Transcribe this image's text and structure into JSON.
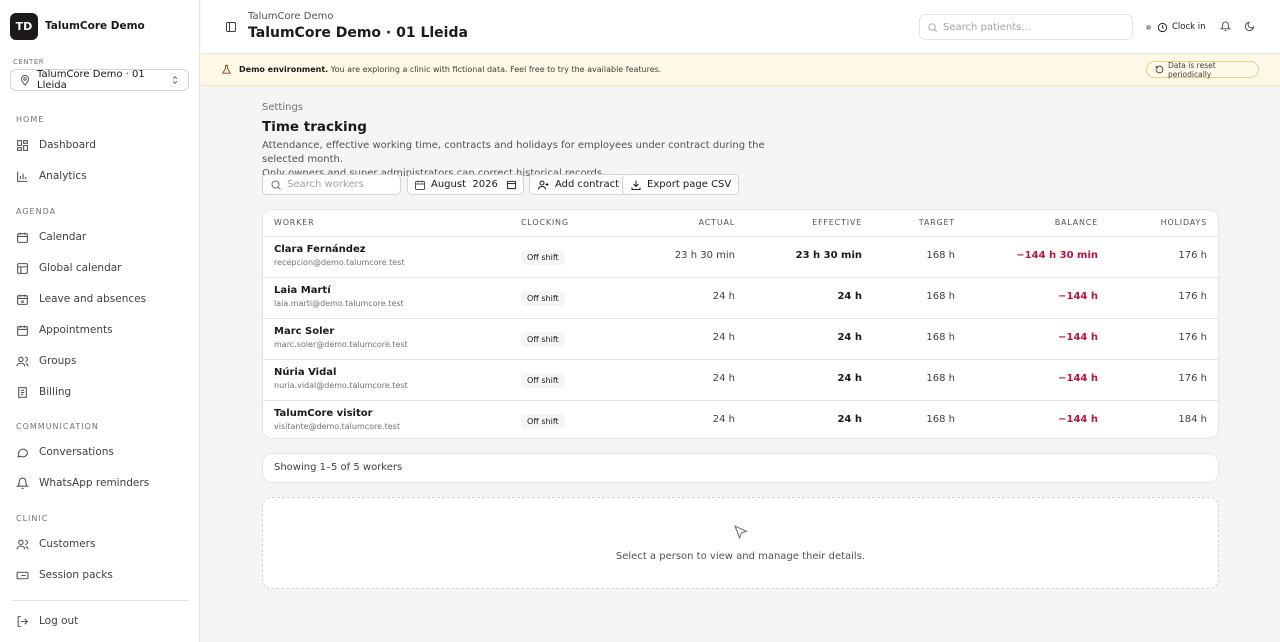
{
  "sidebar": {
    "logo_initials": "TD",
    "brand": "TalumCore Demo",
    "center_label": "CENTER",
    "center_value": "TalumCore Demo · 01 Lleida",
    "sections": {
      "home": "HOME",
      "agenda": "AGENDA",
      "communication": "COMMUNICATION",
      "clinic": "CLINIC"
    },
    "items": {
      "dashboard": "Dashboard",
      "analytics": "Analytics",
      "calendar": "Calendar",
      "global_calendar": "Global calendar",
      "leave": "Leave and absences",
      "appointments": "Appointments",
      "groups": "Groups",
      "billing": "Billing",
      "conversations": "Conversations",
      "whatsapp": "WhatsApp reminders",
      "customers": "Customers",
      "session_packs": "Session packs"
    },
    "logout": "Log out"
  },
  "header": {
    "breadcrumb": "TalumCore Demo",
    "title": "TalumCore Demo · 01 Lleida",
    "search_placeholder": "Search patients...",
    "clock_in": "Clock in"
  },
  "banner": {
    "bold": "Demo environment.",
    "text": " You are exploring a clinic with fictional data. Feel free to try the available features.",
    "reset_label": "Data is reset periodically"
  },
  "page": {
    "breadcrumb": "Settings",
    "title": "Time tracking",
    "description_1": "Attendance, effective working time, contracts and holidays for employees under contract during the selected month.",
    "description_2": "Only owners and super administrators can correct historical records."
  },
  "toolbar": {
    "search_placeholder": "Search workers",
    "month_value": "August  2026",
    "add_contract": "Add contract",
    "export_csv": "Export page CSV"
  },
  "table": {
    "headers": {
      "worker": "WORKER",
      "clocking": "CLOCKING",
      "actual": "ACTUAL",
      "effective": "EFFECTIVE",
      "target": "TARGET",
      "balance": "BALANCE",
      "holidays": "HOLIDAYS"
    },
    "rows": [
      {
        "name": "Clara Fernández",
        "email": "recepcion@demo.talumcore.test",
        "clocking": "Off shift",
        "actual": "23 h 30 min",
        "effective": "23 h 30 min",
        "target": "168 h",
        "balance": "−144 h 30 min",
        "holidays": "176 h"
      },
      {
        "name": "Laia Martí",
        "email": "laia.marti@demo.talumcore.test",
        "clocking": "Off shift",
        "actual": "24 h",
        "effective": "24 h",
        "target": "168 h",
        "balance": "−144 h",
        "holidays": "176 h"
      },
      {
        "name": "Marc Soler",
        "email": "marc.soler@demo.talumcore.test",
        "clocking": "Off shift",
        "actual": "24 h",
        "effective": "24 h",
        "target": "168 h",
        "balance": "−144 h",
        "holidays": "176 h"
      },
      {
        "name": "Núria Vidal",
        "email": "nuria.vidal@demo.talumcore.test",
        "clocking": "Off shift",
        "actual": "24 h",
        "effective": "24 h",
        "target": "168 h",
        "balance": "−144 h",
        "holidays": "176 h"
      },
      {
        "name": "TalumCore visitor",
        "email": "visitante@demo.talumcore.test",
        "clocking": "Off shift",
        "actual": "24 h",
        "effective": "24 h",
        "target": "168 h",
        "balance": "−144 h",
        "holidays": "184 h"
      }
    ]
  },
  "pagination": {
    "summary": "Showing 1–5 of 5 workers"
  },
  "empty_state": {
    "text": "Select a person to view and manage their details."
  },
  "colors": {
    "negative_balance": "#be123c",
    "banner_bg": "#fdf9e6",
    "logo_bg": "#1c1917"
  }
}
